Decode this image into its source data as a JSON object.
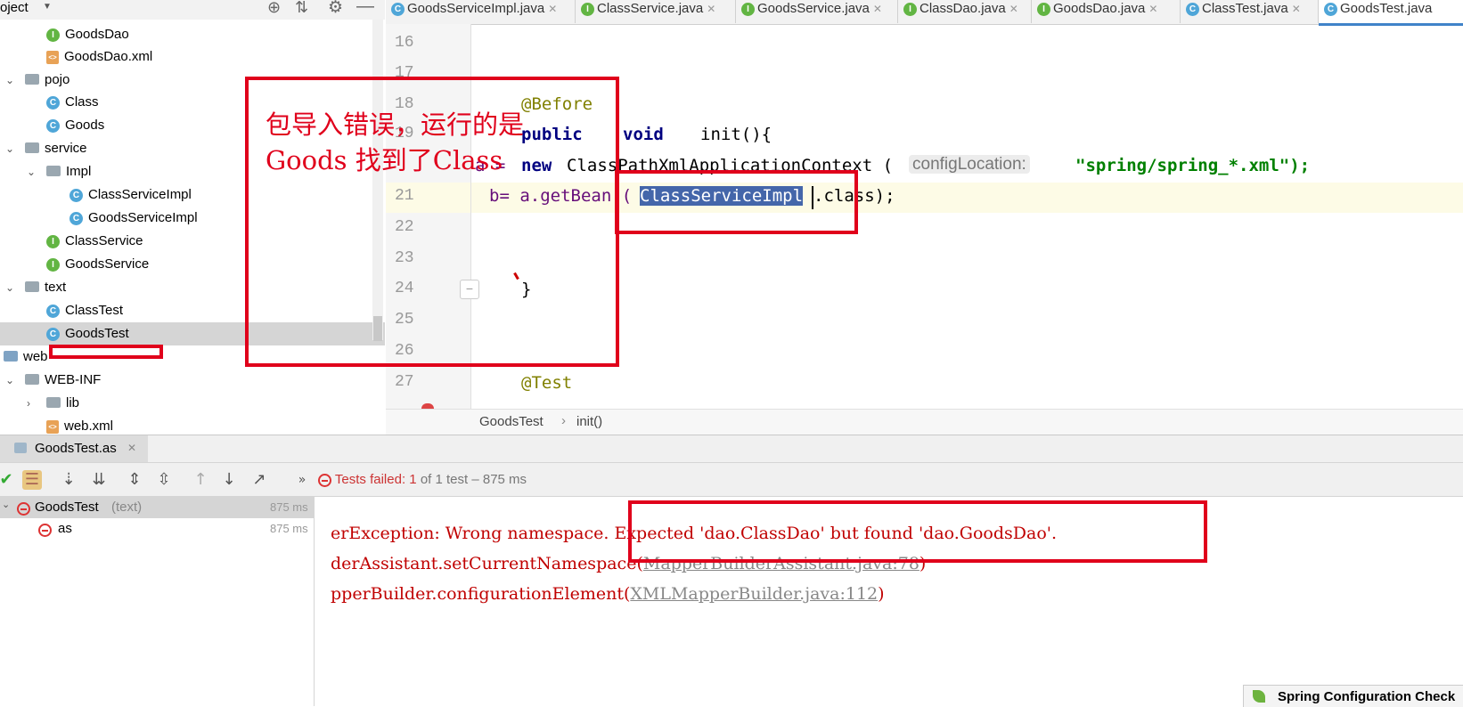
{
  "project": {
    "header": "oject",
    "items": [
      {
        "label": "GoodsDao",
        "icon": "interface-icon",
        "type": "i"
      },
      {
        "label": "GoodsDao.xml",
        "icon": "xml-file-icon",
        "type": "x"
      },
      {
        "label": "pojo",
        "icon": "package-folder-icon",
        "type": "f"
      },
      {
        "label": "Class",
        "icon": "class-icon",
        "type": "c"
      },
      {
        "label": "Goods",
        "icon": "class-icon",
        "type": "c"
      },
      {
        "label": "service",
        "icon": "package-folder-icon",
        "type": "f"
      },
      {
        "label": "Impl",
        "icon": "package-folder-icon",
        "type": "f"
      },
      {
        "label": "ClassServiceImpl",
        "icon": "class-icon",
        "type": "c"
      },
      {
        "label": "GoodsServiceImpl",
        "icon": "class-icon",
        "type": "c"
      },
      {
        "label": "ClassService",
        "icon": "interface-icon",
        "type": "i"
      },
      {
        "label": "GoodsService",
        "icon": "interface-icon",
        "type": "i"
      },
      {
        "label": "text",
        "icon": "package-folder-icon",
        "type": "f"
      },
      {
        "label": "ClassTest",
        "icon": "class-icon",
        "type": "c"
      },
      {
        "label": "GoodsTest",
        "icon": "test-class-icon",
        "type": "c"
      },
      {
        "label": "web",
        "icon": "web-folder-icon",
        "type": "f"
      },
      {
        "label": "WEB-INF",
        "icon": "folder-icon",
        "type": "f"
      },
      {
        "label": "lib",
        "icon": "folder-icon",
        "type": "f"
      },
      {
        "label": "web.xml",
        "icon": "xml-file-icon",
        "type": "x"
      }
    ]
  },
  "tabs": [
    {
      "label": "GoodsServiceImpl.java",
      "icon": "class-icon"
    },
    {
      "label": "ClassService.java",
      "icon": "interface-icon"
    },
    {
      "label": "GoodsService.java",
      "icon": "interface-icon"
    },
    {
      "label": "ClassDao.java",
      "icon": "interface-icon"
    },
    {
      "label": "GoodsDao.java",
      "icon": "interface-icon"
    },
    {
      "label": "ClassTest.java",
      "icon": "class-icon"
    },
    {
      "label": "GoodsTest.java",
      "icon": "test-class-icon"
    }
  ],
  "editor": {
    "line_numbers": [
      "16",
      "17",
      "18",
      "19",
      "21",
      "22",
      "23",
      "24",
      "25",
      "26",
      "27"
    ],
    "annotation_before": "@Before",
    "kw_public": "public",
    "kw_void": "void",
    "method_init": "init(){",
    "var_a": "a =",
    "kw_new": "new",
    "ctx_class": "ClassPathXmlApplicationContext (",
    "hint_label": "configLocation:",
    "string_arg": "\"spring/spring_*.xml\");",
    "b_assign": "b= a.getBean (",
    "selected_class": "ClassServiceImpl",
    "class_suffix": ".class);",
    "closing_brace": "}",
    "annotation_test": "@Test"
  },
  "overlay_note": {
    "line1": "包导入错误，运行的是",
    "line2": "Goods 找到了Class"
  },
  "breadcrumb": {
    "class": "GoodsTest",
    "sep": "›",
    "method": "init()"
  },
  "run": {
    "tab_label": "GoodsTest.as",
    "status_label": "Tests failed:",
    "status_count": "1",
    "status_rest": "of 1 test – 875 ms",
    "tree": [
      {
        "label": "GoodsTest",
        "sub": "(text)",
        "time": "875 ms"
      },
      {
        "label": "as",
        "sub": "",
        "time": "875 ms"
      }
    ]
  },
  "console": {
    "line1": "erException: Wrong namespace. Expected 'dao.ClassDao' but found 'dao.GoodsDao'.",
    "line2_text": "derAssistant.setCurrentNamespace(",
    "line2_link": "MapperBuilderAssistant.java:78",
    "line2_end": ")",
    "line3_text": "pperBuilder.configurationElement(",
    "line3_link": "XMLMapperBuilder.java:112",
    "line3_end": ")"
  },
  "notification": "Spring Configuration Check",
  "colors": {
    "annotation_box": "#e0001b",
    "selection": "#4466aa",
    "error_text": "#c00000"
  }
}
